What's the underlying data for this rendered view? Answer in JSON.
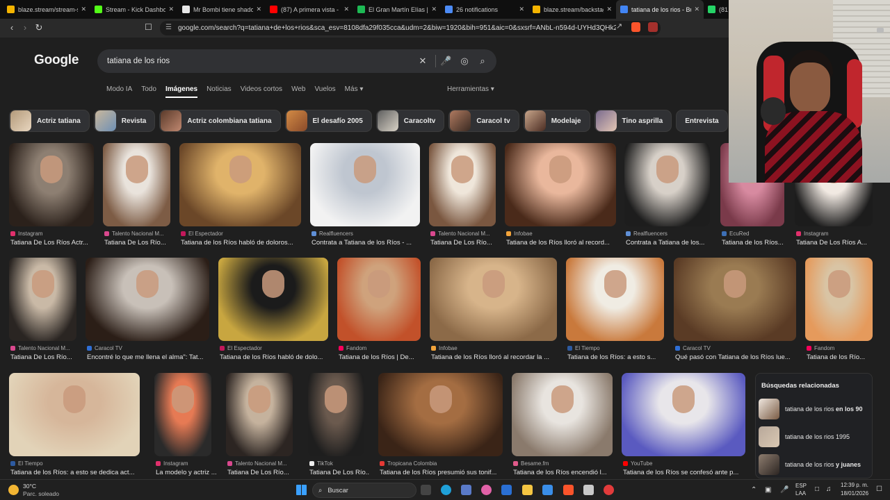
{
  "browser": {
    "tabs": [
      {
        "title": "blaze.stream/stream-setti",
        "color": "#f4b400"
      },
      {
        "title": "Stream - Kick Dashboa",
        "color": "#53fc18"
      },
      {
        "title": "Mr Bombi tiene shadowba",
        "color": "#e8e8e8"
      },
      {
        "title": "(87) A primera vista - Pipe",
        "color": "#ff0000"
      },
      {
        "title": "El Gran Martín Elías | Spot",
        "color": "#1db954"
      },
      {
        "title": "26 notifications",
        "color": "#4c8bf5"
      },
      {
        "title": "blaze.stream/backstage",
        "color": "#f4b400"
      },
      {
        "title": "tatiana de los rios - Bu",
        "color": "#4285f4",
        "active": true
      },
      {
        "title": "(81",
        "color": "#25d366"
      }
    ],
    "url": "google.com/search?q=tatiana+de+los+rios&sca_esv=8108dfa29f035cca&udm=2&biw=1920&bih=951&aic=0&sxsrf=ANbL-n594d-UYHd3QHk2Zq..."
  },
  "google": {
    "logo": "Google",
    "query": "tatiana de los rios",
    "filters": [
      "Modo IA",
      "Todo",
      "Imágenes",
      "Noticias",
      "Videos cortos",
      "Web",
      "Vuelos",
      "Más ▾"
    ],
    "active_filter": "Imágenes",
    "tools": "Herramientas ▾",
    "chips": [
      {
        "label": "Actriz tatiana",
        "c1": "#b39a7a",
        "c2": "#e8d6bf"
      },
      {
        "label": "Revista",
        "c1": "#c9b79c",
        "c2": "#6e90b5"
      },
      {
        "label": "Actriz colombiana tatiana",
        "c1": "#5a3a2a",
        "c2": "#c08870"
      },
      {
        "label": "El desafío 2005",
        "c1": "#d38b45",
        "c2": "#8a4a2a"
      },
      {
        "label": "Caracoltv",
        "c1": "#5f5f5f",
        "c2": "#d8d2c6"
      },
      {
        "label": "Caracol tv",
        "c1": "#b07a60",
        "c2": "#3a2a22"
      },
      {
        "label": "Modelaje",
        "c1": "#c8a58a",
        "c2": "#4a2c22"
      },
      {
        "label": "Tino asprilla",
        "c1": "#7a6b8e",
        "c2": "#e3c6b4"
      },
      {
        "label": "Entrevista",
        "c1": "",
        "c2": ""
      }
    ],
    "results": [
      {
        "source": "Instagram",
        "caption": "Tatiana De Los Ríos Actr...",
        "c1": "#8d7f72",
        "c2": "#2b211b",
        "fav": "#e1306c"
      },
      {
        "source": "Talento Nacional M...",
        "caption": "Tatiana De Los Río...",
        "c1": "#e9e3dc",
        "c2": "#7d5c45",
        "fav": "#d9488e"
      },
      {
        "source": "El Espectador",
        "caption": "Tatiana de los Ríos habló de doloros...",
        "c1": "#e0b36a",
        "c2": "#6b4728",
        "fav": "#c2185b"
      },
      {
        "source": "Realfluencers",
        "caption": "Contrata a Tatiana de los Ríos - ...",
        "c1": "#bfc6d0",
        "c2": "#f2f2f2",
        "fav": "#5f8fd6"
      },
      {
        "source": "Talento Nacional M...",
        "caption": "Tatiana De Los Río...",
        "c1": "#efe6da",
        "c2": "#7a5740",
        "fav": "#d9488e"
      },
      {
        "source": "Infobae",
        "caption": "Tatiana de los Ríos lloró al record...",
        "c1": "#e9b79c",
        "c2": "#4a2a1a",
        "fav": "#f2a33a"
      },
      {
        "source": "Realfluencers",
        "caption": "Contrata a Tatiana de los...",
        "c1": "#d7d0c8",
        "c2": "#1d1d1d",
        "fav": "#5f8fd6"
      },
      {
        "source": "EcuRed",
        "caption": "Tatiana de los Ríos...",
        "c1": "#d78aa0",
        "c2": "#7a3a4a",
        "fav": "#3d6fb5"
      },
      {
        "source": "Instagram",
        "caption": "Tatiana De Los Ríos A...",
        "c1": "#f1e9e2",
        "c2": "#1c1c1c",
        "fav": "#e1306c"
      },
      {
        "source": "Talento Nacional M...",
        "caption": "Tatiana De Los Río...",
        "c1": "#c9b9a6",
        "c2": "#2a2522",
        "fav": "#d9488e"
      },
      {
        "source": "Caracol TV",
        "caption": "Encontré lo que me llena el alma\": Tat...",
        "c1": "#c8c0b8",
        "c2": "#2b1e17",
        "fav": "#2f6fd6"
      },
      {
        "source": "El Espectador",
        "caption": "Tatiana de los Ríos habló de dolo...",
        "c1": "#1b1b1b",
        "c2": "#c8a640",
        "fav": "#c2185b"
      },
      {
        "source": "Fandom",
        "caption": "Tatiana de los Ríos | De...",
        "c1": "#cfa27c",
        "c2": "#c2512a",
        "fav": "#fa005a"
      },
      {
        "source": "Infobae",
        "caption": "Tatiana de los Ríos lloró al recordar la ...",
        "c1": "#d7b48a",
        "c2": "#8c6a48",
        "fav": "#f2a33a"
      },
      {
        "source": "El Tiempo",
        "caption": "Tatiana de los Ríos: a esto s...",
        "c1": "#f0ece3",
        "c2": "#c9793c",
        "fav": "#2d5aa0"
      },
      {
        "source": "Caracol TV",
        "caption": "Qué pasó con Tatiana de los Ríos lue...",
        "c1": "#9a7b52",
        "c2": "#5a3b25",
        "fav": "#2f6fd6"
      },
      {
        "source": "Fandom",
        "caption": "Tatiana de los Río...",
        "c1": "#d9c4a4",
        "c2": "#e59a5c",
        "fav": "#fa005a"
      },
      {
        "source": "El Tiempo",
        "caption": "Tatiana de los Ríos: a esto se dedica act...",
        "c1": "#d6b69a",
        "c2": "#e2d3b8",
        "fav": "#2d5aa0"
      },
      {
        "source": "Instagram",
        "caption": "La modelo y actriz ...",
        "c1": "#e67a54",
        "c2": "#2a2a2a",
        "fav": "#e1306c"
      },
      {
        "source": "Talento Nacional M...",
        "caption": "Tatiana De Los Río...",
        "c1": "#c5b29d",
        "c2": "#2c2522",
        "fav": "#d9488e"
      },
      {
        "source": "TikTok",
        "caption": "Tatiana De Los Río...",
        "c1": "#6b5a4e",
        "c2": "#1e1e1e",
        "fav": "#eeeeee"
      },
      {
        "source": "Tropicana Colombia",
        "caption": "Tatiana de los Ríos presumió sus tonif...",
        "c1": "#a46d42",
        "c2": "#3a2417",
        "fav": "#e53935"
      },
      {
        "source": "Besame.fm",
        "caption": "Tatiana de los Ríos encendió l...",
        "c1": "#e8e4df",
        "c2": "#8a7a6c",
        "fav": "#e05a8a"
      },
      {
        "source": "YouTube",
        "caption": "Tatiana de los Ríos se confesó ante p...",
        "c1": "#e8e6ea",
        "c2": "#5a5ac0",
        "fav": "#ff0000"
      }
    ],
    "related_title": "Búsquedas relacionadas",
    "related": [
      {
        "prefix": "tatiana de los rios ",
        "bold": "en los 90",
        "c1": "#efe7df",
        "c2": "#7a5b44"
      },
      {
        "prefix": "tatiana de los rios 1995",
        "bold": "",
        "c1": "#b8a89a",
        "c2": "#d9c8b3"
      },
      {
        "prefix": "tatiana de los rios ",
        "bold": "y juanes",
        "c1": "#8e7d6f",
        "c2": "#2c2522"
      }
    ]
  },
  "taskbar": {
    "weather_temp": "30°C",
    "weather_desc": "Parc. soleado",
    "search_label": "Buscar",
    "lang_top": "ESP",
    "lang_bottom": "LAA",
    "time": "12:39 p. m.",
    "date": "18/01/2026"
  }
}
